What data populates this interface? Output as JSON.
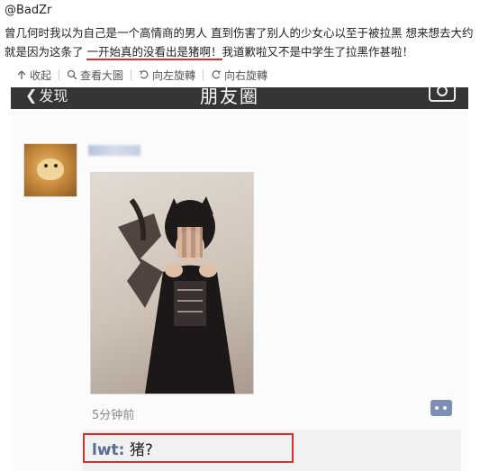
{
  "post": {
    "author": "@BadZr",
    "text_before": "曾几何时我以为自己是一个高情商的男人 直到伤害了别人的少女心以至于被拉黑 想来想去大约就是因为这条了 ",
    "text_highlight": "一开始真的没看出是猪啊！",
    "text_after": "我道歉啦又不是中学生了拉黑作甚啦！"
  },
  "toolbar": {
    "collapse": "收起",
    "view_large": "查看大圖",
    "rotate_left": "向左旋轉",
    "rotate_right": "向右旋轉"
  },
  "moments": {
    "nav_back": "发现",
    "nav_title": "朋友圈",
    "time": "5分钟前",
    "comment_user": "lwt:",
    "comment_text": "猪?"
  }
}
